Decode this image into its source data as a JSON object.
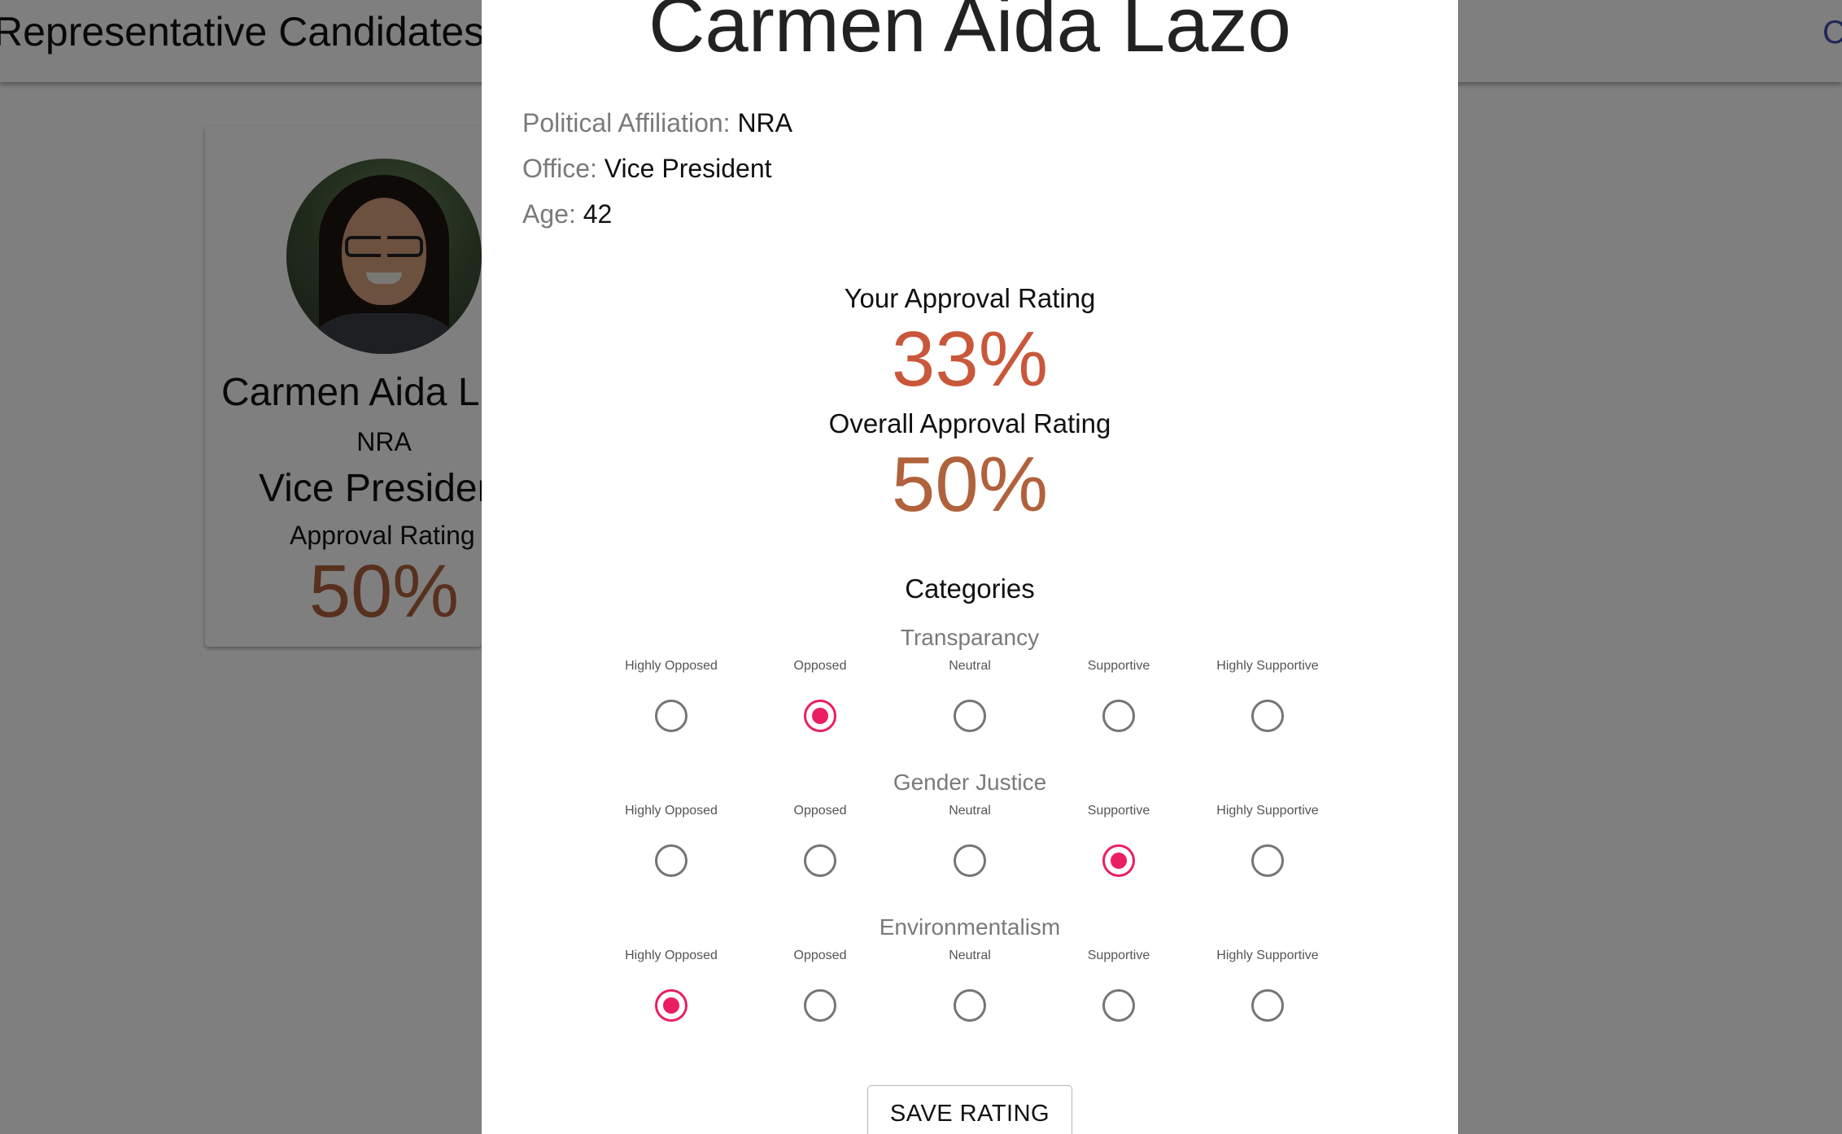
{
  "appbar": {
    "title": "Representative Candidates",
    "right_text": "C"
  },
  "card": {
    "name": "Carmen Aida L",
    "party": "NRA",
    "office": "Vice Presiden",
    "rating_label": "Approval Rating",
    "rating_value": "50%"
  },
  "modal": {
    "title": "Carmen Aida Lazo",
    "affiliation_key": "Political Affiliation:",
    "affiliation_value": "NRA",
    "office_key": "Office:",
    "office_value": "Vice President",
    "age_key": "Age:",
    "age_value": "42",
    "your_approval_label": "Your Approval Rating",
    "your_approval_value": "33%",
    "overall_approval_label": "Overall Approval Rating",
    "overall_approval_value": "50%",
    "categories_heading": "Categories",
    "options": [
      "Highly Opposed",
      "Opposed",
      "Neutral",
      "Supportive",
      "Highly Supportive"
    ],
    "categories": [
      {
        "name": "Transparancy",
        "selected": "Opposed"
      },
      {
        "name": "Gender Justice",
        "selected": "Supportive"
      },
      {
        "name": "Environmentalism",
        "selected": "Highly Opposed"
      }
    ],
    "save_label": "SAVE RATING"
  },
  "colors": {
    "your_approval": "#c9573a",
    "overall_approval": "#b0623c",
    "radio_checked": "#e91e63",
    "radio_unchecked": "#757575"
  }
}
